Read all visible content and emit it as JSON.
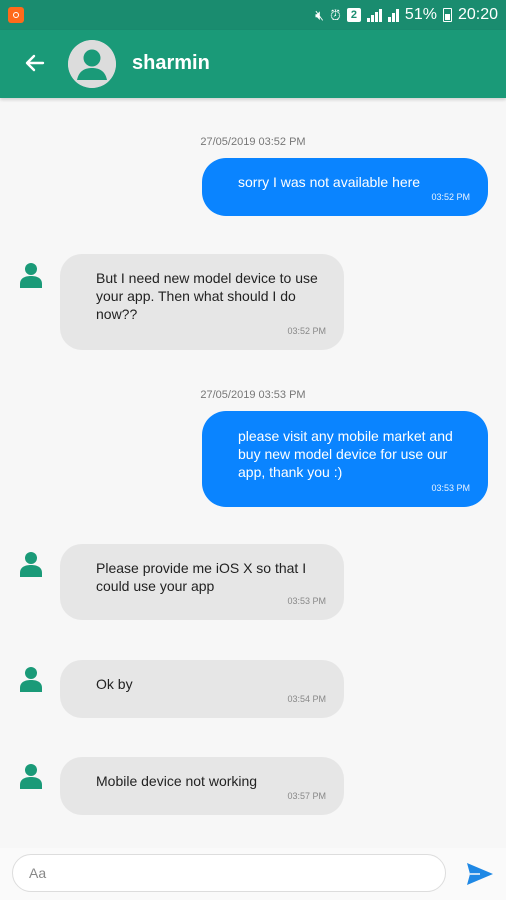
{
  "status_bar": {
    "battery": "51%",
    "time": "20:20",
    "badge": "2"
  },
  "header": {
    "contact_name": "sharmin"
  },
  "messages": [
    {
      "date": "27/05/2019 03:52 PM"
    },
    {
      "direction": "out",
      "text": "sorry I was not available here",
      "time": "03:52 PM"
    },
    {
      "direction": "in",
      "text": "But I need new model device to use your app. Then what should I do now??",
      "time": "03:52 PM"
    },
    {
      "date": "27/05/2019 03:53 PM"
    },
    {
      "direction": "out",
      "text": "please visit any mobile market and buy new model device for use our app, thank you :)",
      "time": "03:53 PM"
    },
    {
      "direction": "in",
      "text": "Please provide me iOS X so that I could use your app",
      "time": "03:53 PM"
    },
    {
      "direction": "in",
      "text": "Ok by",
      "time": "03:54 PM"
    },
    {
      "direction": "in",
      "text": "Mobile device not working",
      "time": "03:57 PM"
    }
  ],
  "composer": {
    "placeholder": "Aa"
  },
  "colors": {
    "header": "#1a9a78",
    "status_bar": "#1a8c6f",
    "outgoing_bubble": "#0a84ff",
    "incoming_bubble": "#e6e6e6",
    "contact_icon": "#1a9a78",
    "send_icon": "#1e88e5"
  },
  "icons": {
    "back": "arrow-left",
    "avatar": "person-circle",
    "contact": "person",
    "send": "paper-plane"
  }
}
